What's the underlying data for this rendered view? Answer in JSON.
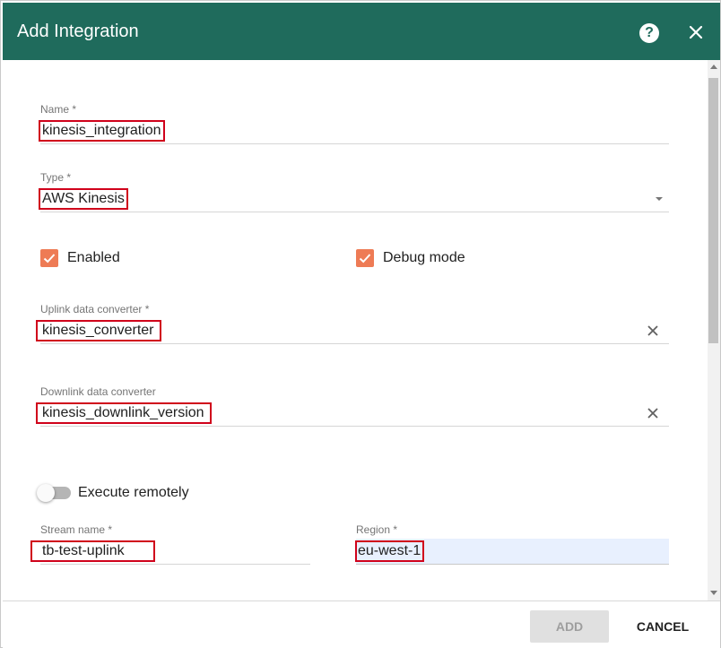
{
  "dialog": {
    "title": "Add Integration",
    "help_icon": "help-circle-icon",
    "close_icon": "close-icon"
  },
  "form": {
    "name": {
      "label": "Name *",
      "value": "kinesis_integration"
    },
    "type": {
      "label": "Type *",
      "value": "AWS Kinesis"
    },
    "enabled": {
      "label": "Enabled",
      "checked": true
    },
    "debug_mode": {
      "label": "Debug mode",
      "checked": true
    },
    "uplink_converter": {
      "label": "Uplink data converter *",
      "value": "kinesis_converter"
    },
    "downlink_converter": {
      "label": "Downlink data converter",
      "value": "kinesis_downlink_version"
    },
    "execute_remotely": {
      "label": "Execute remotely",
      "on": false
    },
    "stream_name": {
      "label": "Stream name *",
      "value": "tb-test-uplink"
    },
    "region": {
      "label": "Region *",
      "value": "eu-west-1"
    }
  },
  "footer": {
    "add_label": "ADD",
    "cancel_label": "CANCEL"
  },
  "colors": {
    "header": "#1f6b5c",
    "checkbox": "#ee7b55",
    "highlight": "#d0021b",
    "autofill": "#e8f0fe"
  }
}
